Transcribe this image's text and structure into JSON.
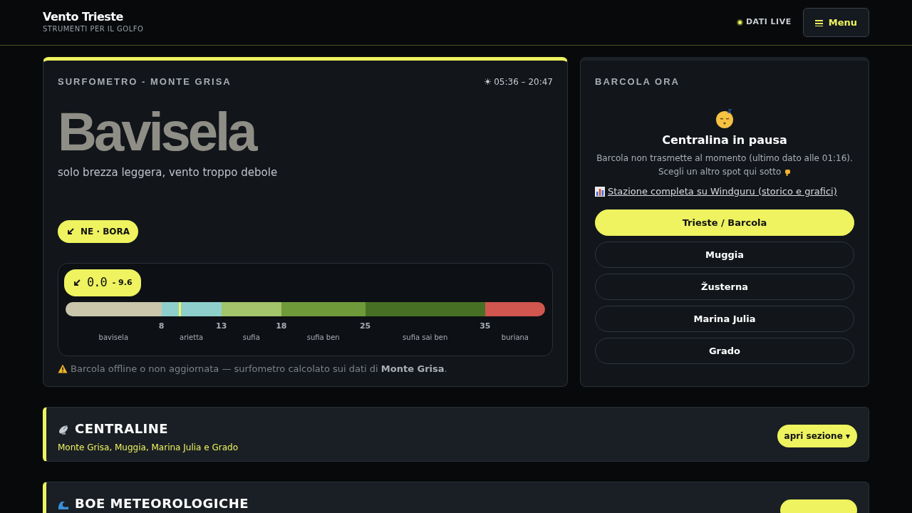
{
  "header": {
    "title": "Vento Trieste",
    "subtitle": "STRUMENTI PER IL GOLFO",
    "live": {
      "label": "DATI LIVE",
      "on": true
    },
    "menu_button": "Menu"
  },
  "surfometro": {
    "label": "SURFOMETRO - MONTE GRISA",
    "sun_times": "05:36 – 20:47",
    "verdict": "Bavisela",
    "description": "solo brezza leggera, vento troppo debole",
    "direction_badge": "NE · BORA",
    "scale": {
      "reading": "0.0",
      "gust": "- 9.6",
      "level": 0.236,
      "zones": [
        {
          "name": "bavisela",
          "color": "#c9c6ac"
        },
        {
          "name": "arietta",
          "tick": "8",
          "color": "#8ecfcb"
        },
        {
          "name": "sufia",
          "tick": "13",
          "color": "#a3c46a"
        },
        {
          "name": "sufia ben",
          "tick": "18",
          "color": "#6f9a3a"
        },
        {
          "name": "sufia sai ben",
          "tick": "25",
          "color": "#477024"
        },
        {
          "name": "buriana",
          "tick": "35",
          "color": "#d0564f"
        }
      ]
    },
    "note": "Barcola offline o non aggiornata — surfometro calcolato sui dati di **Monte Grisa**."
  },
  "station": {
    "label": "BARCOLA ORA",
    "status_title": "Centralina in pausa",
    "status_text": "Barcola non trasmette al momento (ultimo dato alle 01:16). Scegli un altro spot qui sotto",
    "link": "Stazione completa su Windguru (storico e grafici)",
    "spots": [
      {
        "label": "Trieste / Barcola",
        "selected": true
      },
      {
        "label": "Muggia",
        "selected": false
      },
      {
        "label": "Žusterna",
        "selected": false
      },
      {
        "label": "Marina Julia",
        "selected": false
      },
      {
        "label": "Grado",
        "selected": false
      }
    ]
  },
  "sections": [
    {
      "kind": "antenna",
      "title": "CENTRALINE",
      "subtitle": "Monte Grisa, Muggia, Marina Julia e Grado",
      "button": "apri sezione ▾"
    },
    {
      "kind": "wave",
      "title": "BOE METEOROLOGICHE"
    }
  ]
}
